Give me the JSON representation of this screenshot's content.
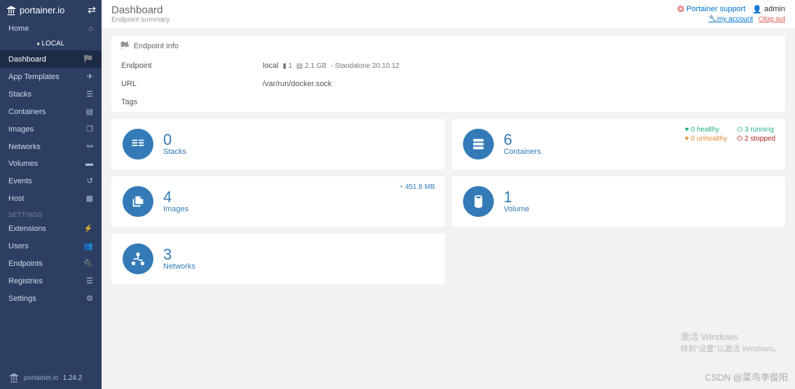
{
  "brand": "portainer.io",
  "version": "1.24.2",
  "header": {
    "title": "Dashboard",
    "subtitle": "Endpoint summary",
    "support": "Portainer support",
    "user": "admin",
    "account": "my account",
    "logout": "log out"
  },
  "sidebar": {
    "home": "Home",
    "local": "LOCAL",
    "items": [
      {
        "label": "Dashboard",
        "icon": "tachometer"
      },
      {
        "label": "App Templates",
        "icon": "rocket"
      },
      {
        "label": "Stacks",
        "icon": "th-list"
      },
      {
        "label": "Containers",
        "icon": "server"
      },
      {
        "label": "Images",
        "icon": "clone"
      },
      {
        "label": "Networks",
        "icon": "sitemap"
      },
      {
        "label": "Volumes",
        "icon": "hdd"
      },
      {
        "label": "Events",
        "icon": "history"
      },
      {
        "label": "Host",
        "icon": "th"
      }
    ],
    "section": "SETTINGS",
    "settings": [
      {
        "label": "Extensions",
        "icon": "bolt"
      },
      {
        "label": "Users",
        "icon": "users"
      },
      {
        "label": "Endpoints",
        "icon": "plug"
      },
      {
        "label": "Registries",
        "icon": "database"
      },
      {
        "label": "Settings",
        "icon": "cogs"
      }
    ]
  },
  "endpoint": {
    "panel_title": "Endpoint info",
    "rows": {
      "endpoint_label": "Endpoint",
      "endpoint_value": "local",
      "cpu": "1",
      "mem": "2.1 GB",
      "mode": "Standalone 20.10.12",
      "url_label": "URL",
      "url_value": "/var/run/docker.sock",
      "tags_label": "Tags",
      "tags_value": ""
    }
  },
  "cards": {
    "stacks": {
      "count": "0",
      "label": "Stacks"
    },
    "containers": {
      "count": "6",
      "label": "Containers",
      "healthy": "0 healthy",
      "unhealthy": "0 unhealthy",
      "running": "3 running",
      "stopped": "2 stopped"
    },
    "images": {
      "count": "4",
      "label": "Images",
      "size": "451.8 MB"
    },
    "volume": {
      "count": "1",
      "label": "Volume"
    },
    "networks": {
      "count": "3",
      "label": "Networks"
    }
  },
  "watermark": {
    "l1": "激活 Windows",
    "l2": "转到\"设置\"以激活 Windows。"
  },
  "csdn": "CSDN @菜鸟李俊阳"
}
